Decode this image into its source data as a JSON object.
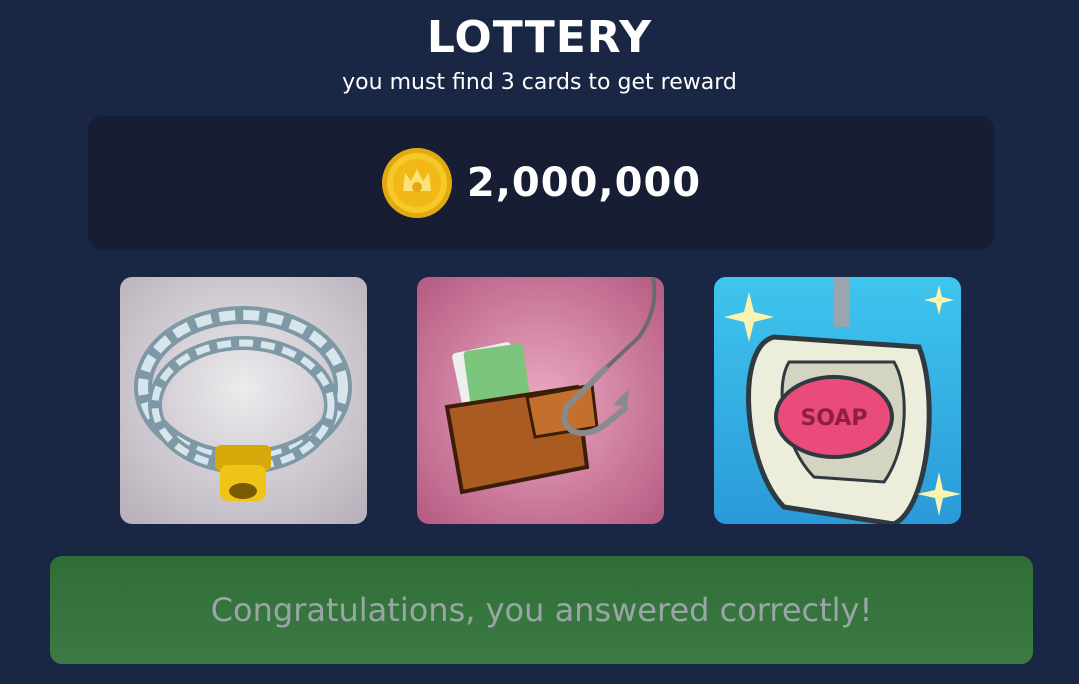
{
  "header": {
    "title": "LOTTERY",
    "subtitle": "you must find 3 cards to get reward"
  },
  "reward": {
    "icon": "gold-coin-icon",
    "amount": "2,000,000"
  },
  "cards": [
    {
      "icon": "chain-necklace-icon"
    },
    {
      "icon": "wallet-on-hook-icon"
    },
    {
      "icon": "soap-in-urinal-icon",
      "label": "SOAP"
    }
  ],
  "result": {
    "message": "Congratulations, you answered correctly!",
    "color": "#2f6f36"
  }
}
